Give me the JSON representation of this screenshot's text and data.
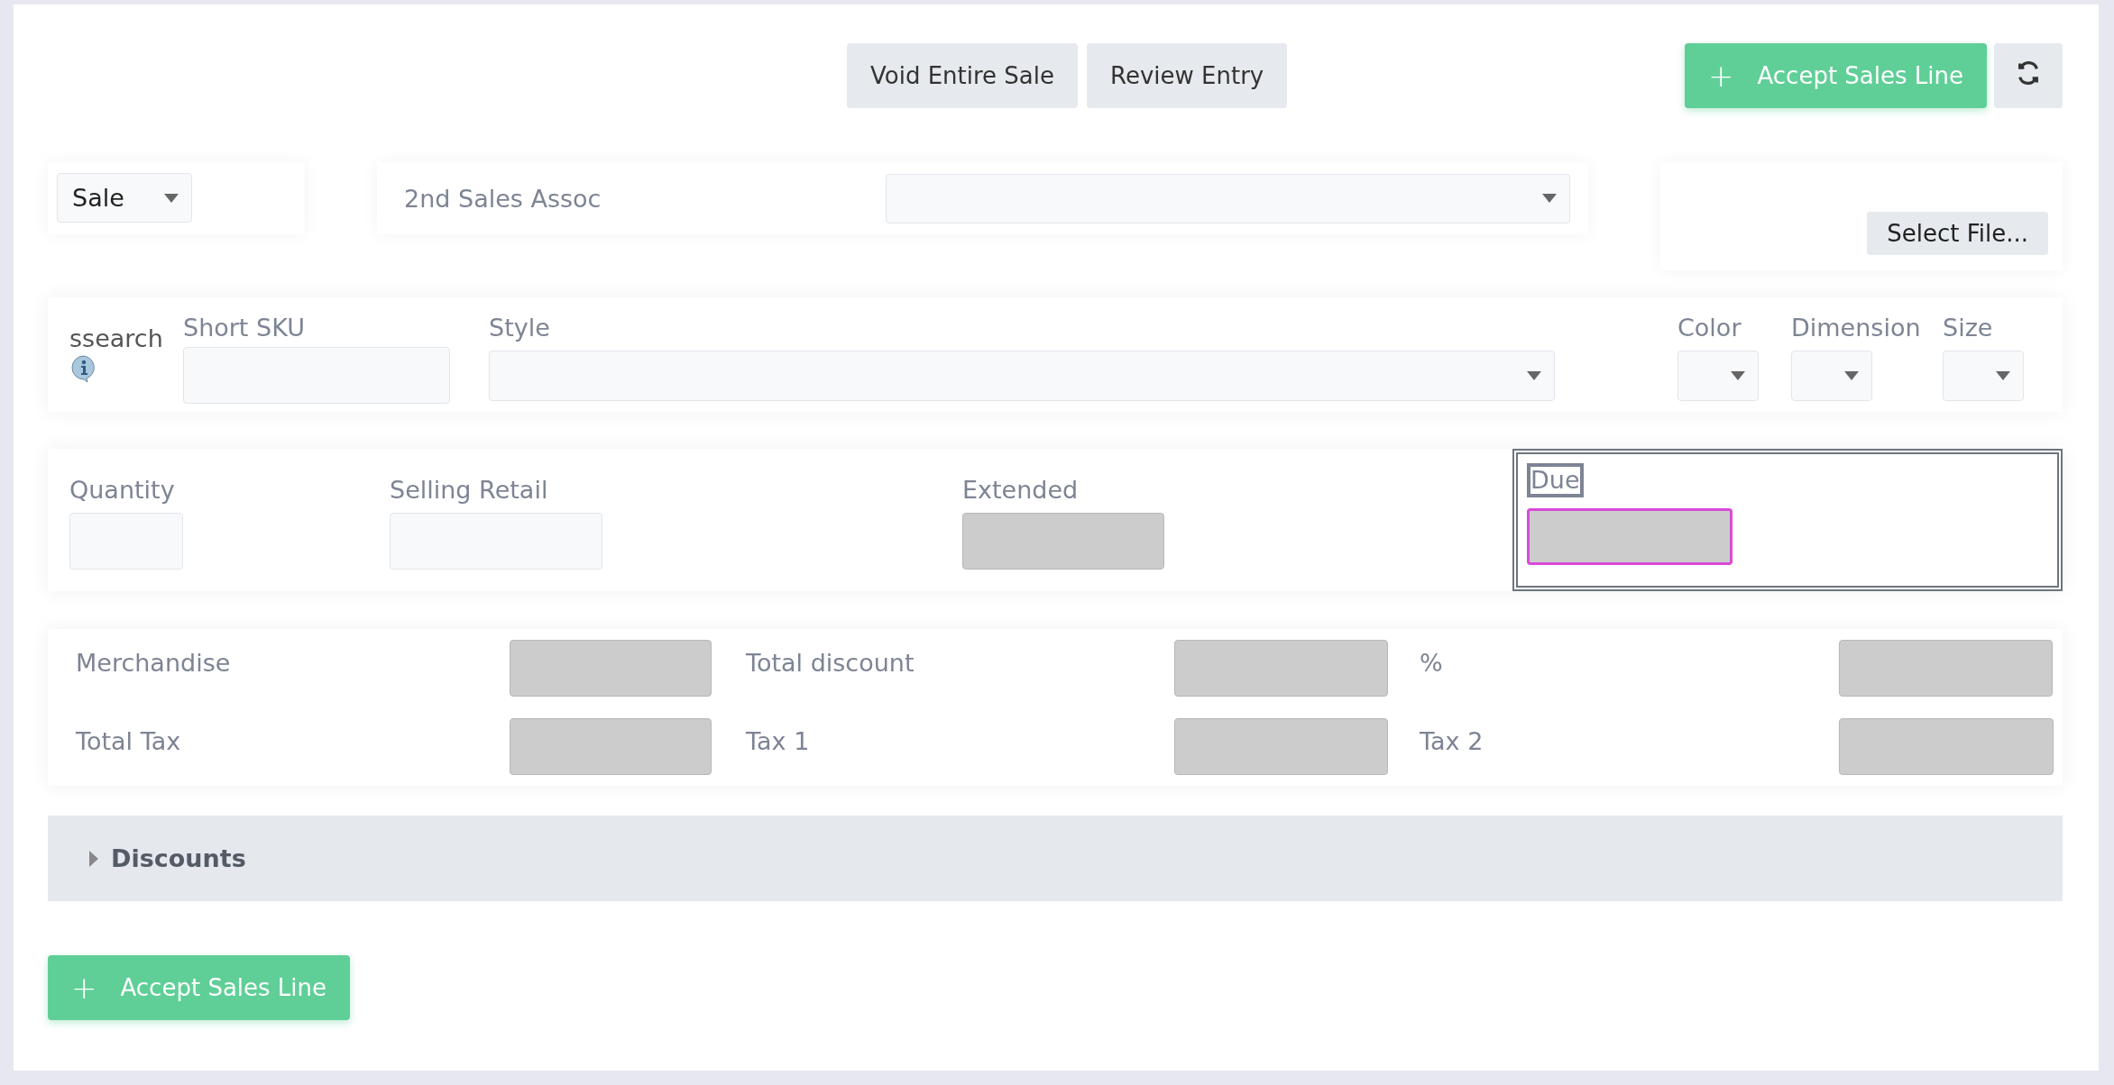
{
  "toolbar": {
    "buttons": [
      {
        "label": "Void Entire Sale"
      },
      {
        "label": "Review Entry"
      }
    ],
    "accept": {
      "icon": "+",
      "label": "Accept Sales Line"
    }
  },
  "sale_type": {
    "value": "Sale"
  },
  "second_assoc": {
    "label": "2nd Sales Assoc"
  },
  "file": {
    "button": "Select File..."
  },
  "item": {
    "search_label": "ssearch",
    "short_sku": {
      "label": "Short SKU"
    },
    "style": {
      "label": "Style"
    },
    "variants": [
      {
        "label": "Color"
      },
      {
        "label": "Dimension"
      },
      {
        "label": "Size"
      }
    ]
  },
  "line": [
    {
      "label": "Quantity",
      "disabled": false
    },
    {
      "label": "Selling Retail",
      "disabled": false
    },
    {
      "label": "Extended",
      "disabled": true
    }
  ],
  "due": {
    "label": "Due",
    "disabled": true,
    "focused": true,
    "boxed": true
  },
  "totals": [
    [
      {
        "label": "Merchandise",
        "disabled": true
      },
      {
        "label": "Total discount",
        "disabled": true
      },
      {
        "label": "%",
        "disabled": true
      }
    ],
    [
      {
        "label": "Total Tax",
        "disabled": true
      },
      {
        "label": "Tax 1",
        "disabled": true
      },
      {
        "label": "Tax 2",
        "disabled": true
      }
    ]
  ],
  "discounts": {
    "label": "Discounts",
    "expanded": false
  },
  "footer": {
    "accept": {
      "icon": "+",
      "label": "Accept Sales Line"
    }
  }
}
